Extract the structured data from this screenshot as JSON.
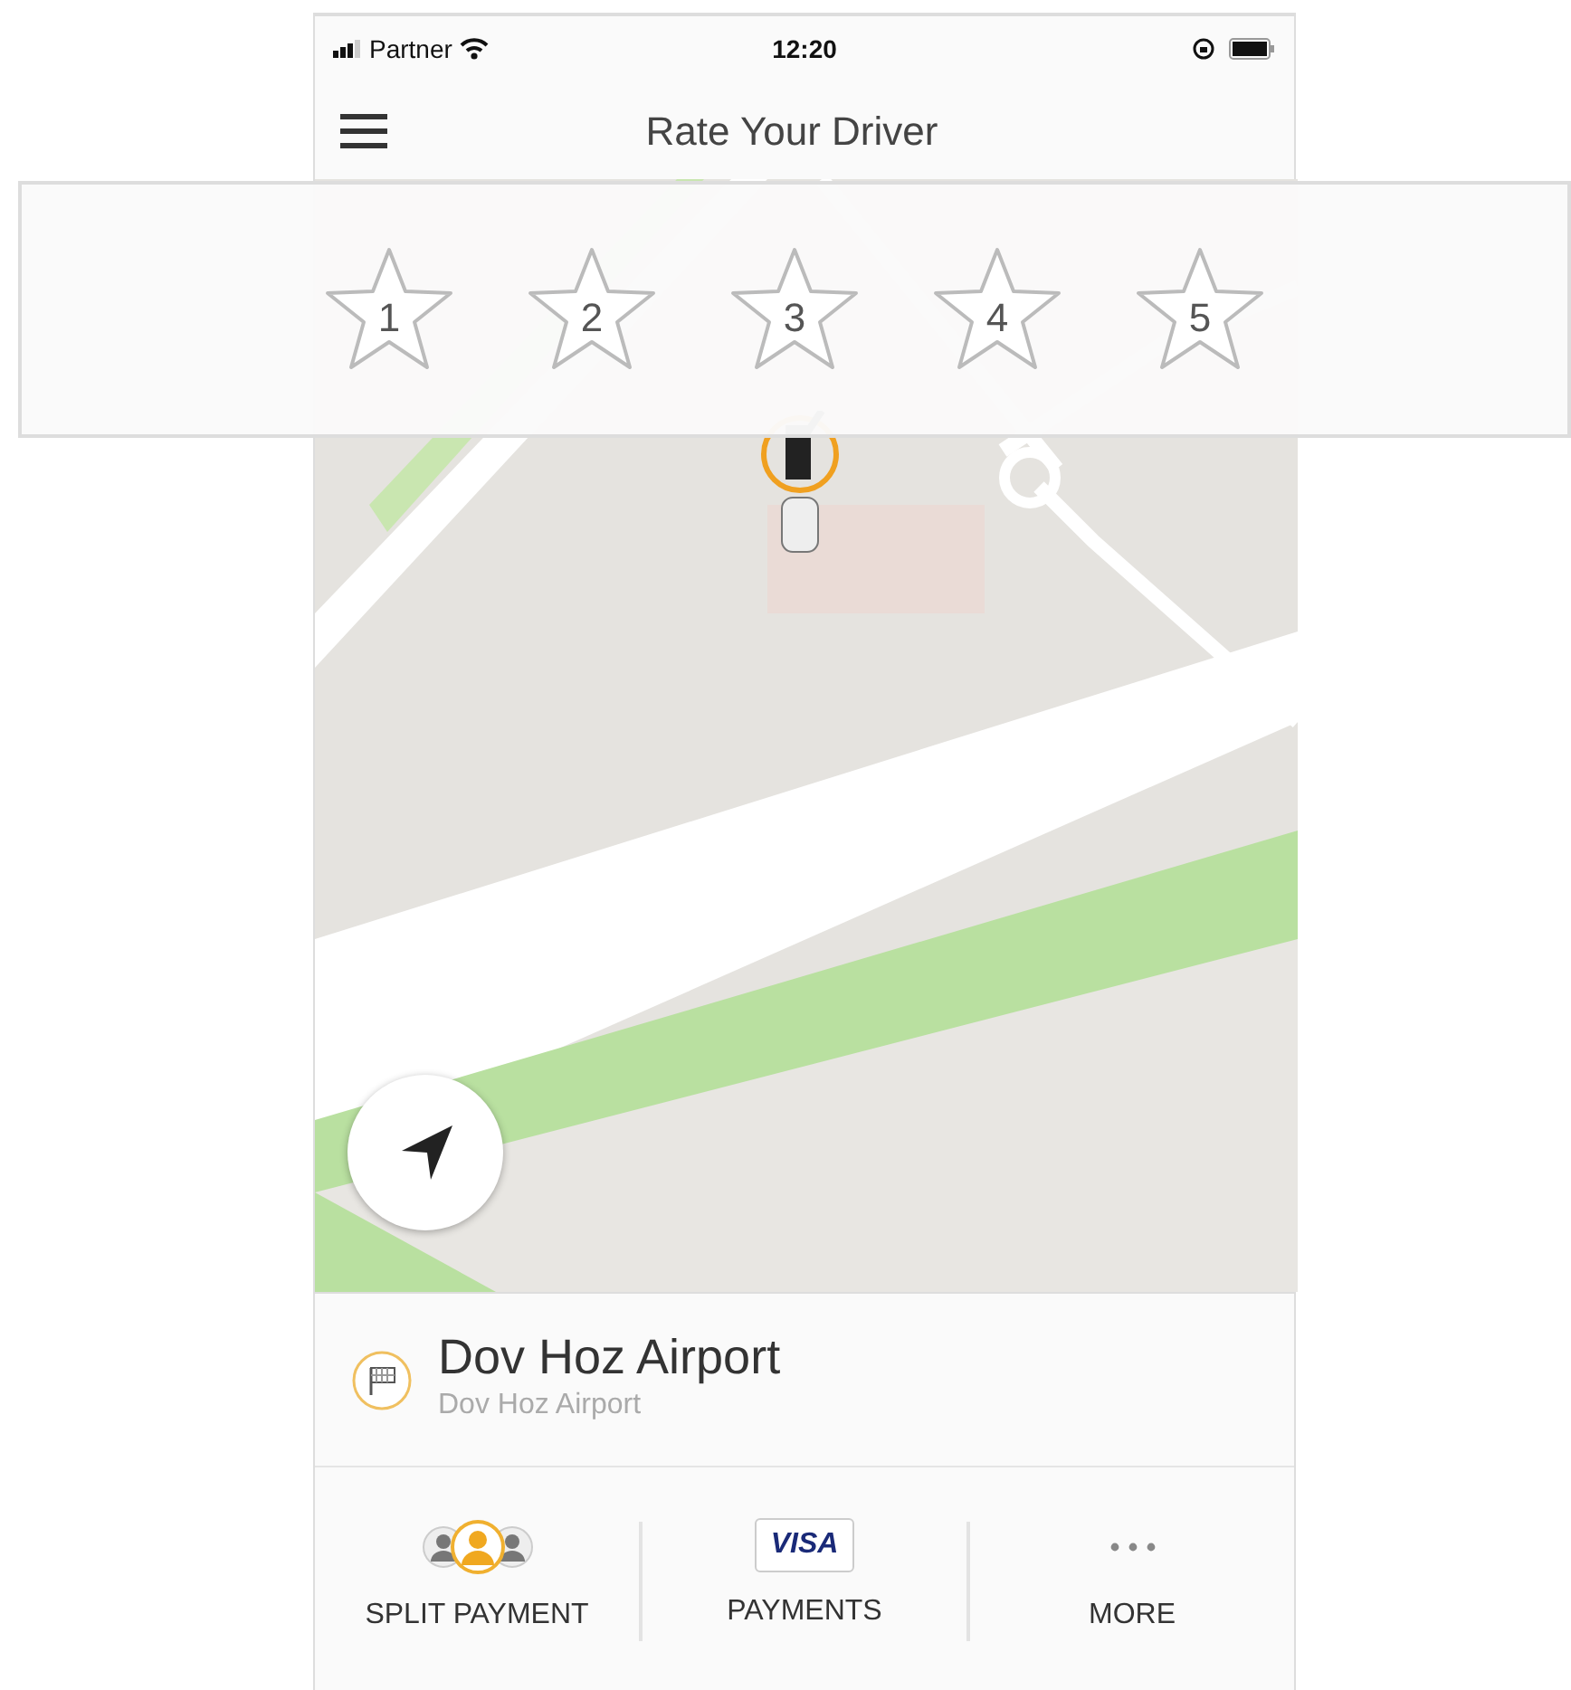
{
  "status_bar": {
    "carrier": "Partner",
    "time": "12:20"
  },
  "header": {
    "title": "Rate Your Driver"
  },
  "rating": {
    "stars": 0,
    "labels": [
      "1",
      "2",
      "3",
      "4",
      "5"
    ]
  },
  "destination": {
    "title": "Dov Hoz Airport",
    "subtitle": "Dov Hoz Airport"
  },
  "actions": [
    {
      "kind": "split",
      "label": "SPLIT PAYMENT"
    },
    {
      "kind": "card",
      "label": "PAYMENTS",
      "card_text": "VISA"
    },
    {
      "kind": "more",
      "label": "MORE"
    }
  ]
}
